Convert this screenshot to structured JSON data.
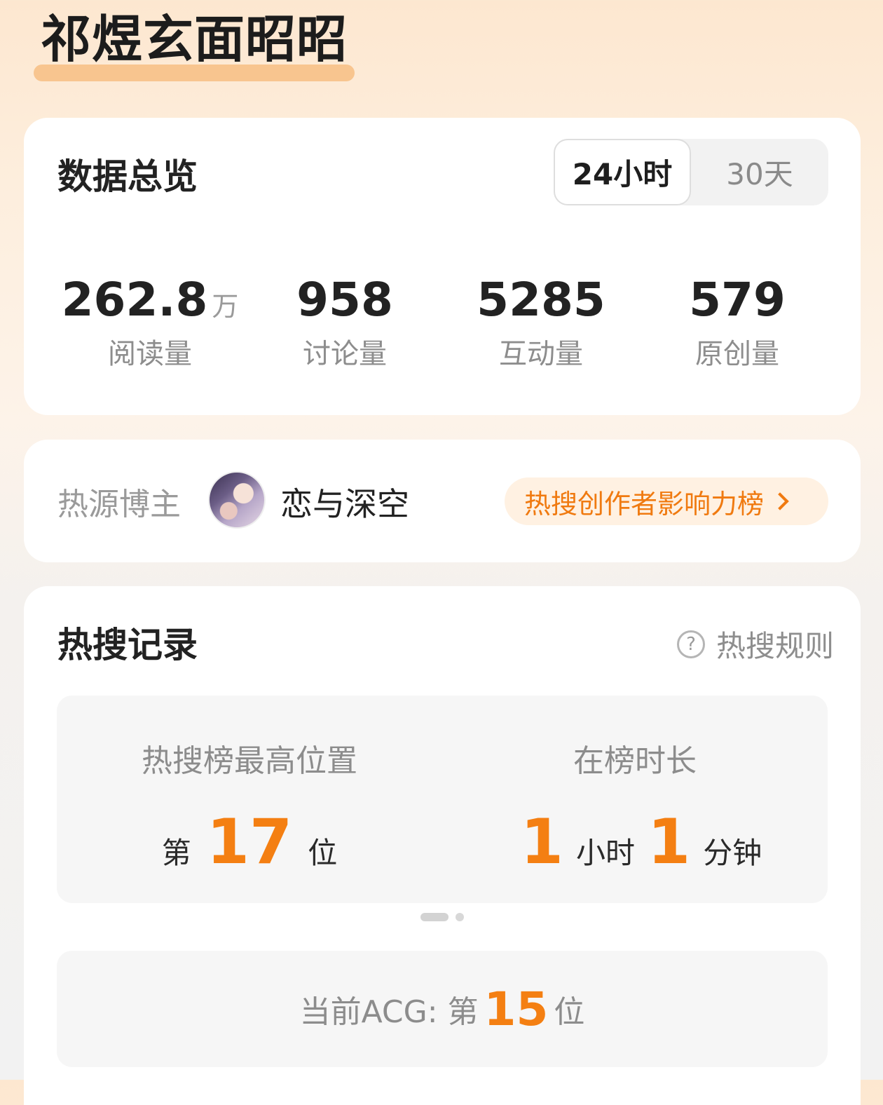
{
  "topic": {
    "title": "祁煜玄面昭昭"
  },
  "overview": {
    "heading": "数据总览",
    "toggle": {
      "active": "24小时",
      "inactive": "30天"
    },
    "stats": [
      {
        "value": "262.8",
        "unit": "万",
        "label": "阅读量"
      },
      {
        "value": "958",
        "unit": "",
        "label": "讨论量"
      },
      {
        "value": "5285",
        "unit": "",
        "label": "互动量"
      },
      {
        "value": "579",
        "unit": "",
        "label": "原创量"
      }
    ]
  },
  "source": {
    "label": "热源博主",
    "name": "恋与深空",
    "link_text": "热搜创作者影响力榜"
  },
  "records": {
    "heading": "热搜记录",
    "rules_icon": "?",
    "rules_text": "热搜规则",
    "peak": {
      "label": "热搜榜最高位置",
      "prefix": "第",
      "value": "17",
      "suffix": "位"
    },
    "duration": {
      "label": "在榜时长",
      "hours": "1",
      "hours_unit": "小时",
      "minutes": "1",
      "minutes_unit": "分钟"
    },
    "current": {
      "label": "当前ACG:",
      "prefix": "第",
      "value": "15",
      "suffix": "位"
    }
  },
  "colors": {
    "accent": "#f47f12",
    "title_underline": "#f8c58f"
  }
}
